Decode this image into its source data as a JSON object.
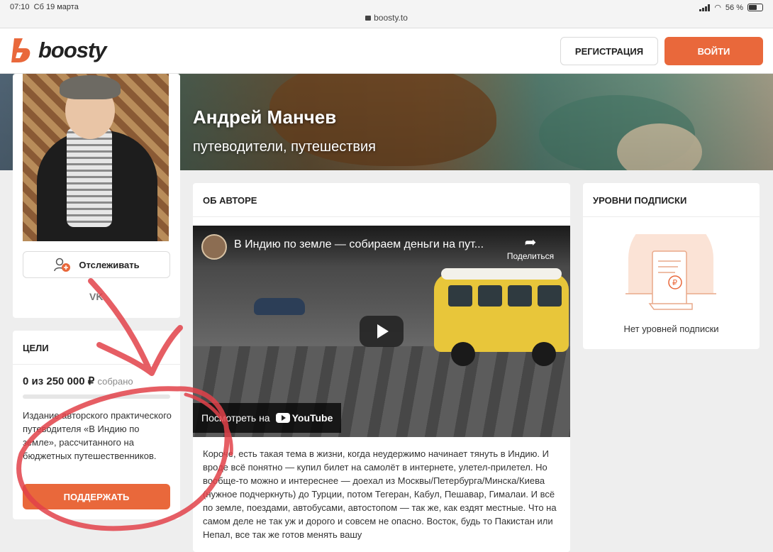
{
  "status_bar": {
    "time": "07:10",
    "date": "Сб 19 марта",
    "domain": "boosty.to",
    "battery": "56 %"
  },
  "header": {
    "logo_text": "boosty",
    "register_label": "РЕГИСТРАЦИЯ",
    "login_label": "ВОЙТИ"
  },
  "profile": {
    "name": "Андрей Манчев",
    "tagline": "путеводители, путешествия",
    "follow_label": "Отслеживать",
    "social": "VK"
  },
  "goals": {
    "title": "ЦЕЛИ",
    "amount": "0 из 250 000 ₽",
    "collected_label": "собрано",
    "progress": 0,
    "description": "Издание авторского практического путеводителя «В Индию по земле», рассчитанного на бюджетных путешественников.",
    "support_label": "ПОДДЕРЖАТЬ"
  },
  "about": {
    "title": "ОБ АВТОРЕ",
    "video_title": "В Индию по земле — собираем деньги на пут...",
    "share_label": "Поделиться",
    "watch_label": "Посмотреть на",
    "youtube_label": "YouTube",
    "text": "Короче, есть такая тема в жизни, когда неудержимо начинает тянуть в Индию. И вроде всё понятно — купил билет на самолёт в интернете, улетел-прилетел. Но вообще-то можно и интереснее — доехал из Москвы/Петербурга/Минска/Киева (нужное подчеркнуть) до Турции, потом Тегеран, Кабул, Пешавар, Гималаи. И всё по земле, поездами, автобусами, автостопом — так же, как ездят местные. Что на самом деле не так уж и дорого и совсем не опасно. Восток, будь то Пакистан или Непал, все так же готов менять вашу"
  },
  "levels": {
    "title": "УРОВНИ ПОДПИСКИ",
    "empty_label": "Нет уровней подписки"
  },
  "colors": {
    "accent": "#e9683b",
    "annotation": "#e2424a"
  }
}
